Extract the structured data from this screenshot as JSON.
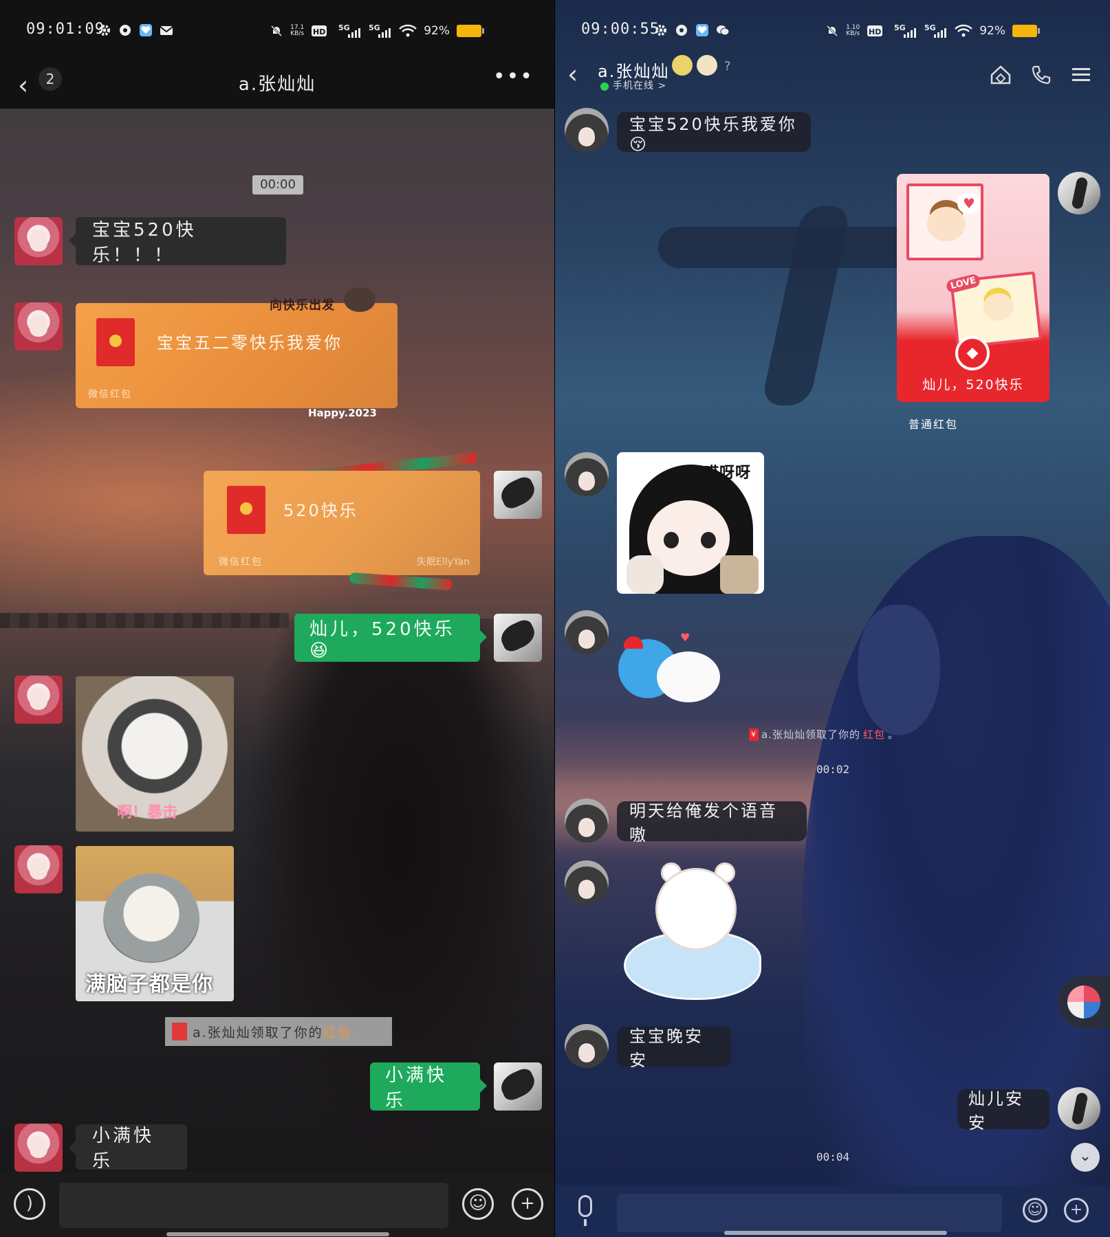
{
  "left": {
    "status": {
      "time": "09:01:09",
      "speed_top": "17.1",
      "speed_bottom": "KB/s",
      "battery": "92%"
    },
    "header": {
      "back_badge": "2",
      "title": "a.张灿灿",
      "more": "•••"
    },
    "timestamp": "00:00",
    "messages": {
      "m1": "宝宝520快乐！！！",
      "rp1_title": "宝宝五二零快乐我爱你",
      "rp1_sub": "微信红包",
      "rp1_deco_top": "向快乐出发",
      "rp1_deco_bottom": "Happy.2023",
      "rp2_title": "520快乐",
      "rp2_sub": "微信红包",
      "rp2_credit": "失眠EllyYan",
      "m_green1": "灿儿，520快乐😆",
      "sticker1_caption": "啊！暴击",
      "sticker2_caption": "满脑子都是你",
      "notice_prefix": "a.张灿灿领取了你的",
      "notice_accent": "红包",
      "m_green2": "小满快乐",
      "m_last": "小满快乐"
    },
    "inputbar": {
      "voice_icon": "voice-icon",
      "emoji_icon": "emoji-icon",
      "plus_icon": "plus-icon"
    }
  },
  "right": {
    "status": {
      "time": "09:00:55",
      "speed_top": "1.10",
      "speed_bottom": "KB/s",
      "battery": "92%"
    },
    "header": {
      "name": "a.张灿灿",
      "online": "手机在线 >"
    },
    "messages": {
      "m1": "宝宝520快乐我爱你😚",
      "redcard_label": "灿儿，520快乐",
      "redcard_caption": "普通红包",
      "girl_sticker_caption": "哎呀呀",
      "love_tag": "LOVE",
      "notice_prefix": "a.张灿灿领取了你的",
      "notice_accent": "红包",
      "notice_suffix": "。",
      "time1": "00:02",
      "m2": "明天给俺发个语音嗷",
      "m3": "宝宝晚安安",
      "m_me": "灿儿安安",
      "time2": "00:04"
    }
  },
  "colors": {
    "wechat_green": "#1ea95c",
    "red_packet": "#e88d3b",
    "qq_red": "#e8272d",
    "battery": "#f5b50a"
  }
}
